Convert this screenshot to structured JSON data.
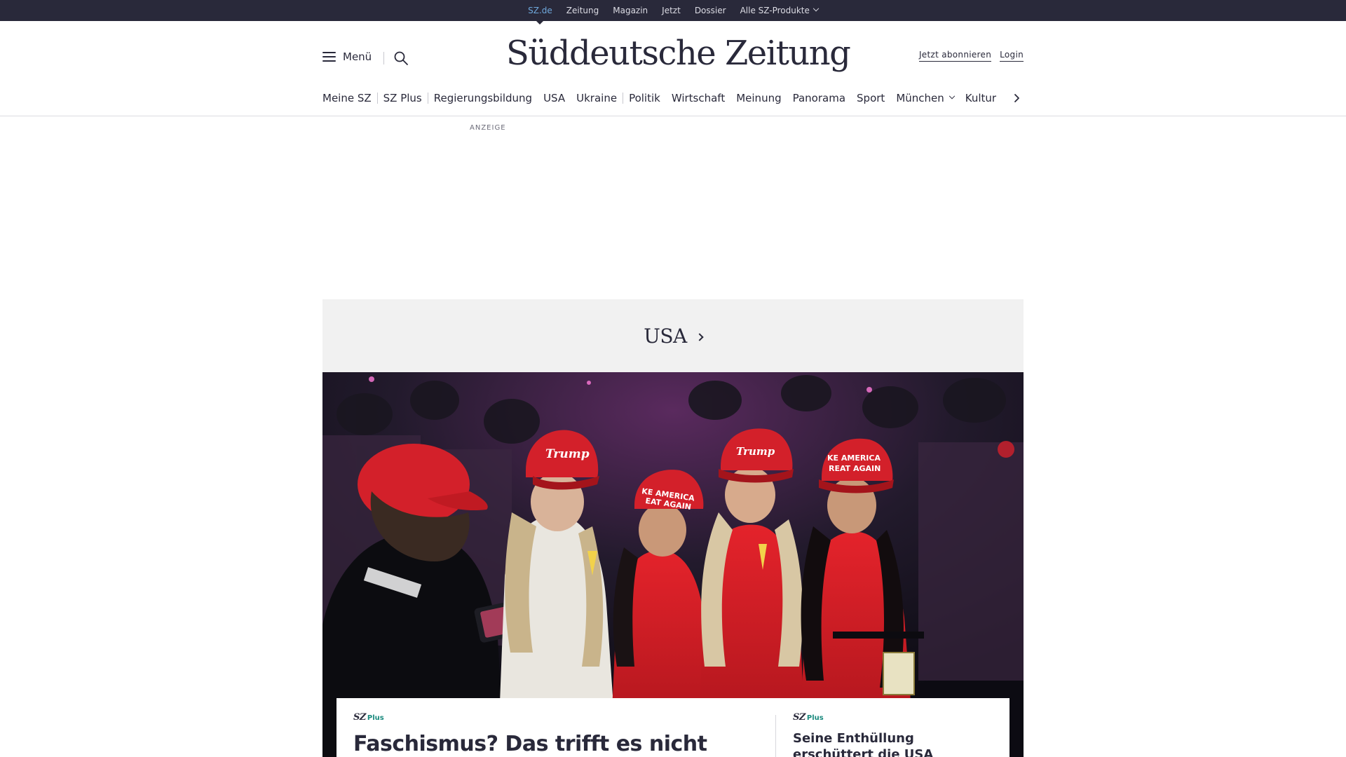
{
  "topbar": {
    "items": [
      {
        "label": "SZ.de",
        "active": true
      },
      {
        "label": "Zeitung"
      },
      {
        "label": "Magazin"
      },
      {
        "label": "Jetzt"
      },
      {
        "label": "Dossier"
      },
      {
        "label": "Alle SZ-Produkte",
        "dropdown": true
      }
    ]
  },
  "masthead": {
    "menu_label": "Menü",
    "logo": "Süddeutsche Zeitung",
    "subscribe_label": "Jetzt abonnieren",
    "login_label": "Login"
  },
  "nav": {
    "items": [
      "Meine SZ",
      "SZ Plus",
      "Regierungsbildung",
      "USA",
      "Ukraine",
      "Politik",
      "Wirtschaft",
      "Meinung",
      "Panorama",
      "Sport",
      "München",
      "Kultur"
    ]
  },
  "ad": {
    "label": "ANZEIGE"
  },
  "section": {
    "title": "USA",
    "hero_image_description": "",
    "teaser_main": {
      "brand_sz": "SZ",
      "brand_plus": "Plus",
      "title": "Faschismus? Das trifft es nicht"
    },
    "teaser_side": {
      "brand_sz": "SZ",
      "brand_plus": "Plus",
      "title": "Seine Enthüllung erschüttert die USA"
    }
  },
  "colors": {
    "topbar_bg": "#29293a",
    "active_link": "#6fa8dc",
    "text": "#29293a",
    "section_bg": "#f1f1f1",
    "plus_accent": "#1a8a7e",
    "cap_red": "#d3202a"
  }
}
